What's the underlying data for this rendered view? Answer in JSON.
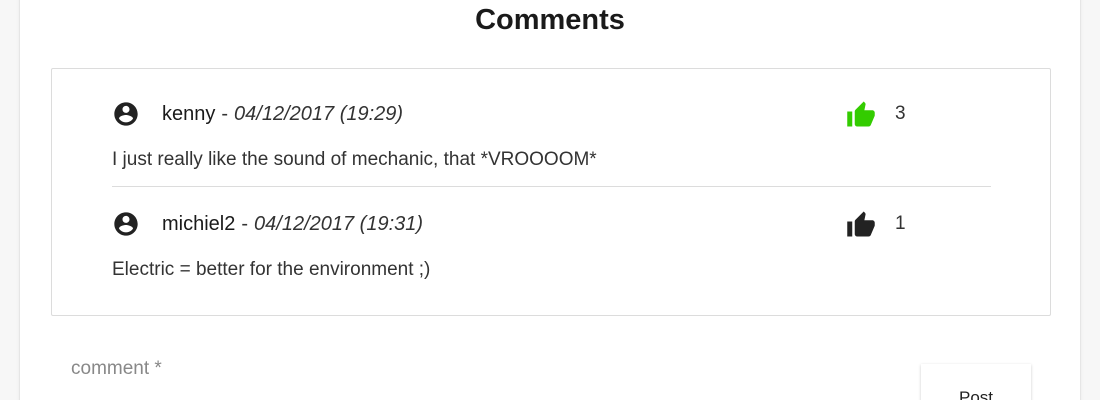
{
  "section": {
    "title": "Comments"
  },
  "comments": [
    {
      "author": "kenny",
      "separator": "-",
      "date": "04/12/2017 (19:29)",
      "likes": "3",
      "liked": true,
      "text": "I just really like the sound of mechanic, that *VROOOOM*",
      "avatar_icon": "account-circle-icon",
      "like_icon": "thumbs-up-icon"
    },
    {
      "author": "michiel2",
      "separator": "-",
      "date": "04/12/2017 (19:31)",
      "likes": "1",
      "liked": false,
      "text": "Electric = better for the environment ;)",
      "avatar_icon": "account-circle-icon",
      "like_icon": "thumbs-up-icon"
    }
  ],
  "form": {
    "comment_label": "comment *",
    "comment_value": "",
    "post_label": "Post"
  },
  "colors": {
    "liked": "#33cc00",
    "not_liked": "#222222"
  }
}
